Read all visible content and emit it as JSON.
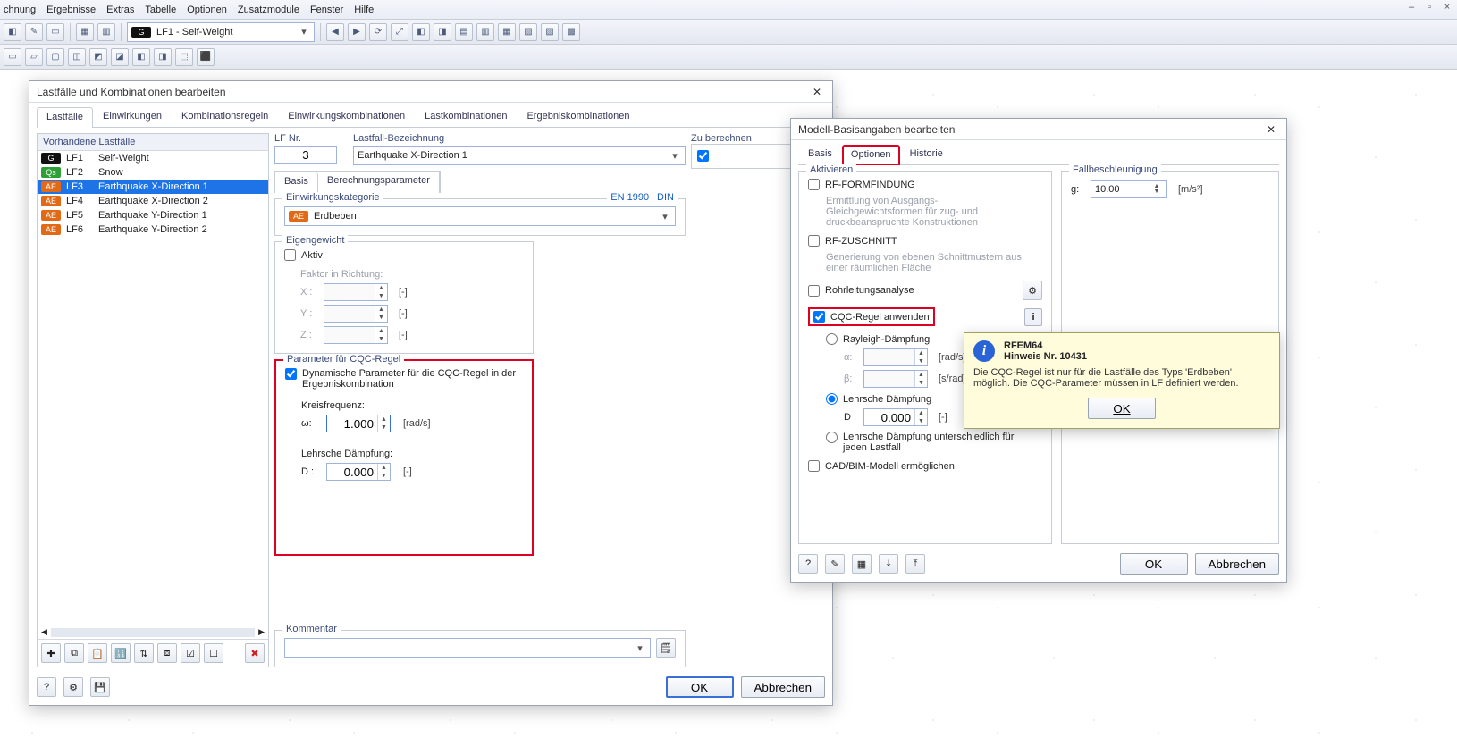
{
  "menu": {
    "items": [
      "chnung",
      "Ergebnisse",
      "Extras",
      "Tabelle",
      "Optionen",
      "Zusatzmodule",
      "Fenster",
      "Hilfe"
    ]
  },
  "toolbar": {
    "combo": "LF1 - Self-Weight"
  },
  "dialog1": {
    "title": "Lastfälle und Kombinationen bearbeiten",
    "tabs": [
      "Lastfälle",
      "Einwirkungen",
      "Kombinationsregeln",
      "Einwirkungskombinationen",
      "Lastkombinationen",
      "Ergebniskombinationen"
    ],
    "active_tab": 0,
    "list_header": "Vorhandene Lastfälle",
    "loadcases": [
      {
        "badge": "G",
        "badgeClass": "badge-g",
        "id": "LF1",
        "name": "Self-Weight"
      },
      {
        "badge": "Qs",
        "badgeClass": "badge-qs",
        "id": "LF2",
        "name": "Snow"
      },
      {
        "badge": "AE",
        "badgeClass": "badge-ae",
        "id": "LF3",
        "name": "Earthquake X-Direction 1",
        "selected": true
      },
      {
        "badge": "AE",
        "badgeClass": "badge-ae",
        "id": "LF4",
        "name": "Earthquake X-Direction 2"
      },
      {
        "badge": "AE",
        "badgeClass": "badge-ae",
        "id": "LF5",
        "name": "Earthquake Y-Direction 1"
      },
      {
        "badge": "AE",
        "badgeClass": "badge-ae",
        "id": "LF6",
        "name": "Earthquake Y-Direction 2"
      }
    ],
    "lfnr_label": "LF Nr.",
    "lfnr_value": "3",
    "name_label": "Lastfall-Bezeichnung",
    "name_value": "Earthquake X-Direction 1",
    "to_calc_label": "Zu berechnen",
    "subtabs": [
      "Basis",
      "Berechnungsparameter"
    ],
    "cat": {
      "title": "Einwirkungskategorie",
      "link_text": "EN 1990 | DIN",
      "badge": "AE",
      "value": "Erdbeben"
    },
    "eigen": {
      "title": "Eigengewicht",
      "active_label": "Aktiv",
      "factor_label": "Faktor in Richtung:",
      "axes": [
        "X :",
        "Y :",
        "Z :"
      ],
      "unit": "[-]"
    },
    "cqc": {
      "title": "Parameter für CQC-Regel",
      "chk_label": "Dynamische Parameter für die CQC-Regel in der Ergebniskombination",
      "freq_label": "Kreisfrequenz:",
      "freq_sym": "ω:",
      "freq_val": "1.000",
      "freq_unit": "[rad/s]",
      "damp_label": "Lehrsche Dämpfung:",
      "damp_sym": "D :",
      "damp_val": "0.000",
      "damp_unit": "[-]"
    },
    "comment_label": "Kommentar",
    "ok": "OK",
    "cancel": "Abbrechen"
  },
  "dialog2": {
    "title": "Modell-Basisangaben bearbeiten",
    "tabs": [
      "Basis",
      "Optionen",
      "Historie"
    ],
    "active_tab": 1,
    "activate_title": "Aktivieren",
    "form": {
      "label": "RF-FORMFINDUNG",
      "desc": "Ermittlung von Ausgangs-Gleichgewichtsformen für zug- und druckbeanspruchte Konstruktionen"
    },
    "cut": {
      "label": "RF-ZUSCHNITT",
      "desc": "Generierung von ebenen Schnittmustern aus einer räumlichen Fläche"
    },
    "pipe_label": "Rohrleitungsanalyse",
    "cqc_label": "CQC-Regel anwenden",
    "rayleigh_label": "Rayleigh-Dämpfung",
    "alpha_sym": "α:",
    "alpha_unit": "[rad/s]",
    "beta_sym": "β:",
    "beta_unit": "[s/rad]",
    "lehr_label": "Lehrsche Dämpfung",
    "d_sym": "D :",
    "d_val": "0.000",
    "d_unit": "[-]",
    "lehr_per_lf_label": "Lehrsche Dämpfung unterschiedlich für jeden Lastfall",
    "cad_label": "CAD/BIM-Modell ermöglichen",
    "fall_title": "Fallbeschleunigung",
    "g_sym": "g:",
    "g_val": "10.00",
    "g_unit": "[m/s²]",
    "ok": "OK",
    "cancel": "Abbrechen"
  },
  "tooltip": {
    "app": "RFEM64",
    "title": "Hinweis Nr. 10431",
    "body": "Die CQC-Regel ist nur für die Lastfälle des Typs 'Erdbeben' möglich. Die CQC-Parameter müssen in LF definiert werden.",
    "ok": "OK"
  }
}
